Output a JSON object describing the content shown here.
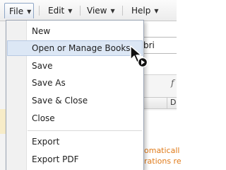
{
  "menubar": {
    "menus": [
      {
        "label": "File",
        "active": true
      },
      {
        "label": "Edit",
        "active": false
      },
      {
        "label": "View",
        "active": false
      },
      {
        "label": "Help",
        "active": false
      }
    ]
  },
  "background": {
    "field_text": "bri",
    "toolbar_glyph": "f",
    "column_header": "D",
    "orange_lines": [
      "omaticall",
      "rations re"
    ]
  },
  "file_menu": {
    "groups": [
      [
        "New",
        "Open or Manage Books"
      ],
      [
        "Save",
        "Save As",
        "Save & Close",
        "Close"
      ],
      [
        "Export",
        "Export PDF"
      ]
    ],
    "hovered_item": "Open or Manage Books"
  },
  "colors": {
    "menu_hover_bg": "#dce7f5",
    "menu_hover_border": "#b7c9e3",
    "active_menu_border": "#8ea6c6",
    "background_text_orange": "#e07b1a"
  },
  "icons": {
    "cursor": "arrow-pointer-with-busy-indicator"
  }
}
